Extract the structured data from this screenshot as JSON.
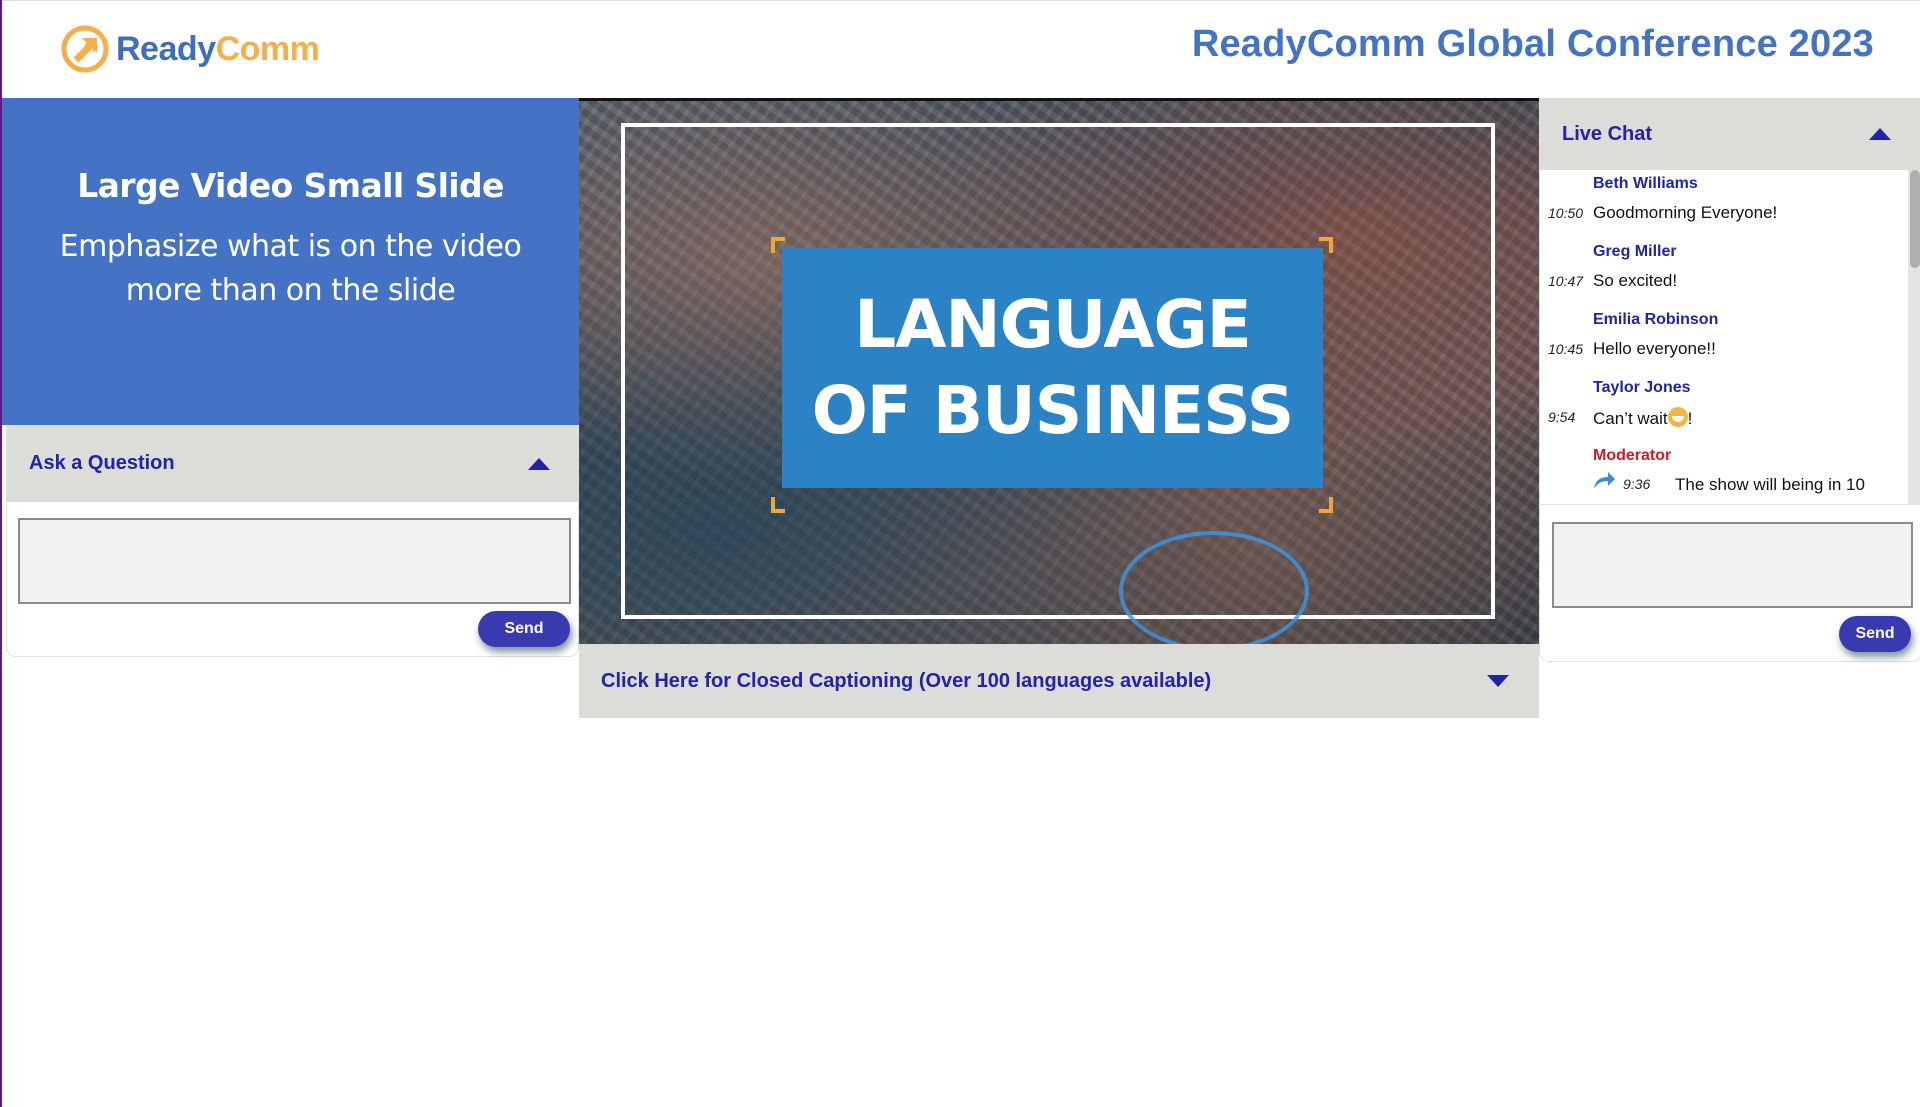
{
  "header": {
    "logo": {
      "part1": "Ready",
      "part2": "Comm",
      "icon": "arrow-circle-icon"
    },
    "title": "ReadyComm Global Conference 2023"
  },
  "slide": {
    "title": "Large Video Small Slide",
    "subtitle_line1": "Emphasize what is on the video",
    "subtitle_line2": "more than on the slide",
    "background_color": "#4472c4"
  },
  "ask_question": {
    "title": "Ask a Question",
    "toggle_icon": "triangle-up-icon",
    "input_value": "",
    "send_label": "Send"
  },
  "video": {
    "title_line1": "LANGUAGE",
    "title_line2": "OF BUSINESS",
    "title_card_color": "#2b82c4",
    "accent_color": "#f0a63a"
  },
  "captions": {
    "label": "Click Here for Closed Captioning (Over 100 languages available)",
    "toggle_icon": "triangle-down-icon"
  },
  "live_chat": {
    "title": "Live Chat",
    "toggle_icon": "triangle-up-icon",
    "messages": [
      {
        "name": "Beth Williams",
        "time": "10:50",
        "text": "Goodmorning Everyone!"
      },
      {
        "name": "Greg Miller",
        "time": "10:47",
        "text": "So excited!"
      },
      {
        "name": "Emilia Robinson",
        "time": "10:45",
        "text": "Hello everyone!!"
      },
      {
        "name": "Taylor Jones",
        "time": "9:54",
        "text": "Can’t wait",
        "text_suffix": "!",
        "emoji": "smiley-emoji-icon"
      },
      {
        "name": "Moderator",
        "time": "9:36",
        "text": "The show will being in 10",
        "icon": "reply-arrow-icon"
      }
    ],
    "input_value": "",
    "send_label": "Send"
  },
  "colors": {
    "accent_blue": "#4472c4",
    "link_blue": "#2222aa",
    "button": "#3a3ab0",
    "moderator_red": "#cc1a2a",
    "logo_orange": "#f5ae4a"
  }
}
